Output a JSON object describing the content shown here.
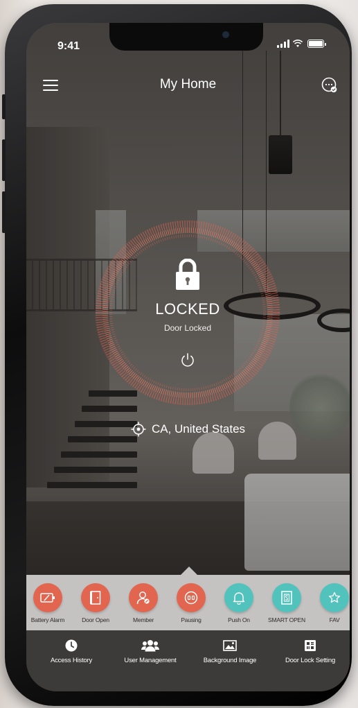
{
  "status_bar": {
    "time": "9:41"
  },
  "header": {
    "title": "My Home",
    "menu_icon": "hamburger-menu-icon",
    "more_icon": "chat-more-icon"
  },
  "lock": {
    "state": "LOCKED",
    "subtitle": "Door Locked",
    "icon": "padlock-icon",
    "action_icon": "power-icon",
    "ring_color": "#e8644f"
  },
  "location": {
    "text": "CA, United States",
    "icon": "location-target-icon"
  },
  "functions": [
    {
      "label": "Battery Alarm",
      "icon": "battery-alarm-icon",
      "color": "#e2664f"
    },
    {
      "label": "Door Open",
      "icon": "door-icon",
      "color": "#e2664f"
    },
    {
      "label": "Member",
      "icon": "member-icon",
      "color": "#e2664f"
    },
    {
      "label": "Pausing",
      "icon": "pause-icon",
      "color": "#e2664f"
    },
    {
      "label": "Push On",
      "icon": "bell-icon",
      "color": "#52c2bd"
    },
    {
      "label": "SMART OPEN",
      "icon": "smart-door-icon",
      "color": "#52c2bd"
    },
    {
      "label": "FAV",
      "icon": "favorite-icon",
      "color": "#52c2bd"
    }
  ],
  "tabs": [
    {
      "label": "Access History",
      "icon": "clock-icon"
    },
    {
      "label": "User Management",
      "icon": "users-icon"
    },
    {
      "label": "Background Image",
      "icon": "image-icon"
    },
    {
      "label": "Door Lock Setting",
      "icon": "settings-grid-icon"
    }
  ]
}
